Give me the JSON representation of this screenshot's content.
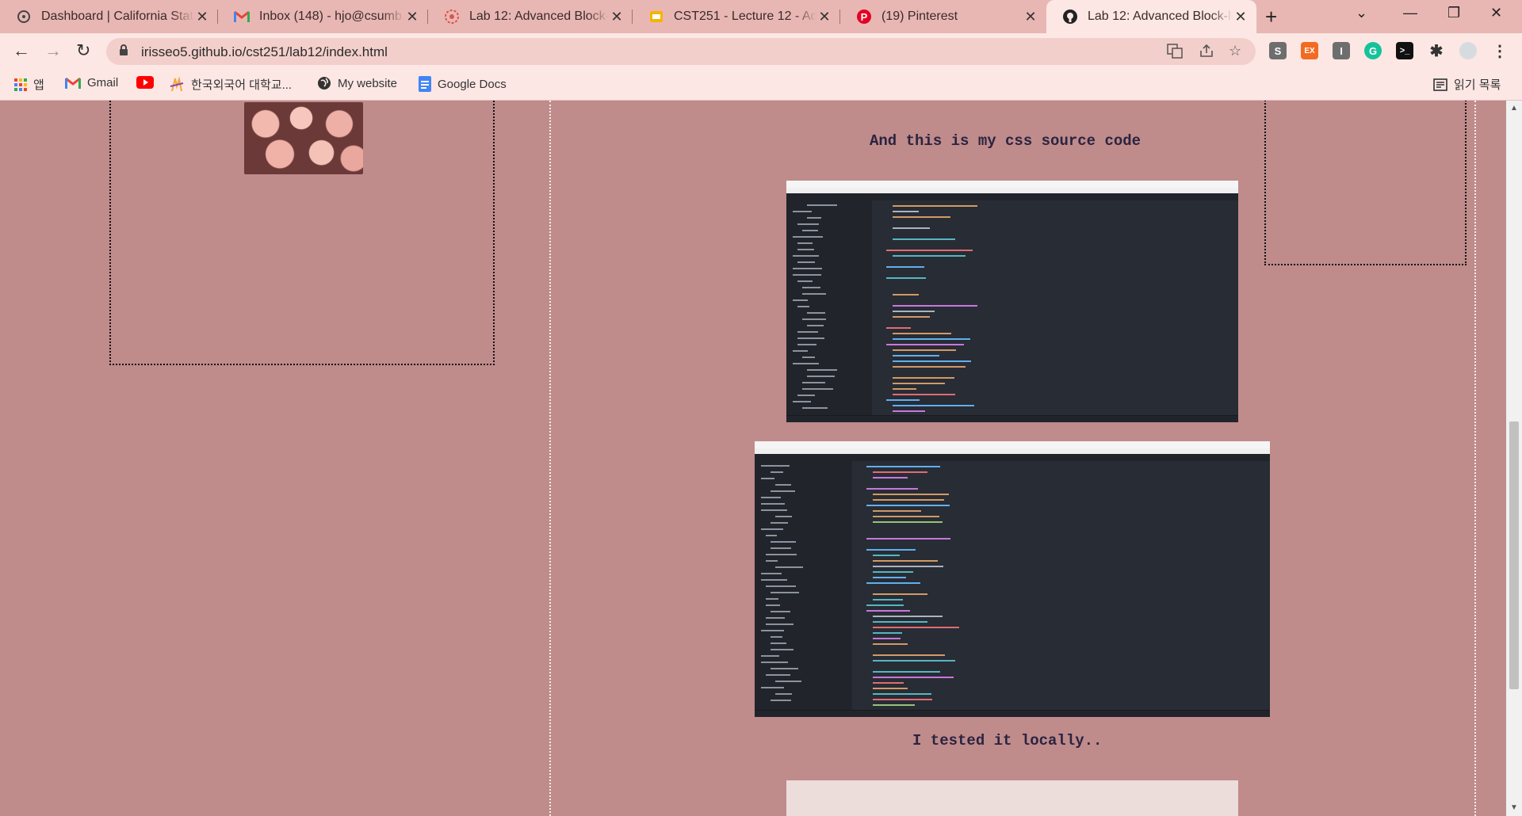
{
  "tabs": [
    {
      "title": "Dashboard | California Stat",
      "icon": "canvas-icon"
    },
    {
      "title": "Inbox (148) - hjo@csumb.e",
      "icon": "gmail-icon"
    },
    {
      "title": "Lab 12: Advanced Block-le",
      "icon": "lab-icon"
    },
    {
      "title": "CST251 - Lecture 12 - Adv",
      "icon": "slides-icon"
    },
    {
      "title": "(19) Pinterest",
      "icon": "pinterest-icon"
    },
    {
      "title": "Lab 12: Advanced Block-le",
      "icon": "github-icon",
      "active": true
    }
  ],
  "toolbar": {
    "url": "irisseo5.github.io/cst251/lab12/index.html"
  },
  "bookmarks": [
    {
      "label": "앱",
      "icon": "apps-grid-icon"
    },
    {
      "label": "Gmail",
      "icon": "gmail-icon"
    },
    {
      "label": "",
      "icon": "youtube-icon"
    },
    {
      "label": "한국외국어 대학교...",
      "icon": "hufs-icon"
    },
    {
      "label": "My website",
      "icon": "globe-icon"
    },
    {
      "label": "Google Docs",
      "icon": "docs-icon"
    }
  ],
  "reading_list": "읽기 목록",
  "extensions": {
    "s": "S",
    "ex": "EX",
    "i": "I",
    "g": "G",
    "terminal": ">_"
  },
  "content": {
    "css_caption": "And this is my css source code",
    "tested_caption": "I tested it locally.."
  },
  "colors": {
    "page_bg": "#c08b8b",
    "tab_strip": "#e8b7b3",
    "toolbar": "#fce7e4",
    "caption": "#2a2440"
  }
}
